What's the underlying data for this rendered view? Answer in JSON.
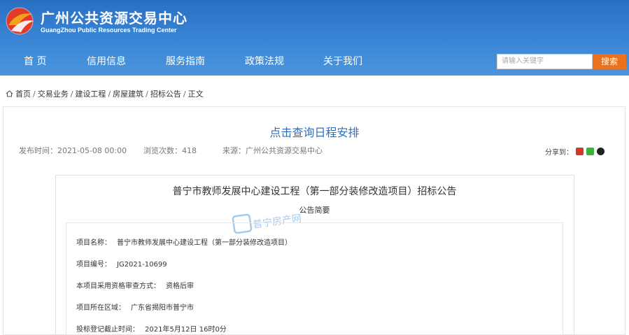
{
  "header": {
    "title": "广州公共资源交易中心",
    "subtitle": "GuangZhou Public Resources Trading Center",
    "brand_color": "#2a6fc2"
  },
  "nav": {
    "items": [
      "首  页",
      "信用信息",
      "服务指南",
      "政策法规",
      "关于我们"
    ]
  },
  "search": {
    "placeholder": "请输入关键字",
    "button_label": "搜索",
    "button_color": "#e8721d"
  },
  "breadcrumb": {
    "items": [
      "首页",
      "交易业务",
      "建设工程",
      "房屋建筑",
      "招标公告",
      "正文"
    ]
  },
  "article": {
    "title": "点击查询日程安排",
    "publish_time": "发布时间：2021-05-08 00:00",
    "views": "浏览次数：418",
    "source": "来源：广州公共资源交易中心",
    "share_label": "分享到："
  },
  "document": {
    "title": "普宁市教师发展中心建设工程（第一部分装修改造项目）招标公告",
    "subtitle": "公告简要",
    "watermark": "普宁房产网",
    "fields": [
      {
        "label": "项目名称：",
        "value": "普宁市教师发展中心建设工程（第一部分装修改造项目）"
      },
      {
        "label": "项目编号：",
        "value": "JG2021-10699"
      },
      {
        "label": "本项目采用资格审查方式：",
        "value": "资格后审"
      },
      {
        "label": "项目所在区域：",
        "value": "广东省揭阳市普宁市"
      },
      {
        "label": "投标登记截止时间：",
        "value": "2021年5月12日 16时0分"
      }
    ]
  }
}
